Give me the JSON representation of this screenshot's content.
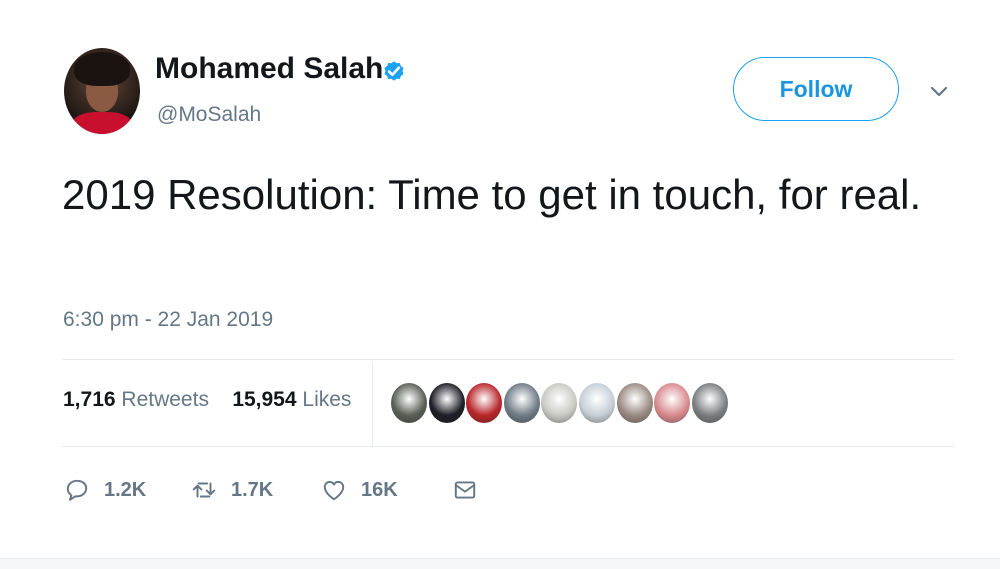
{
  "author": {
    "name": "Mohamed Salah",
    "handle": "@MoSalah",
    "verified": true
  },
  "follow_button": {
    "label": "Follow"
  },
  "tweet": {
    "text": "2019 Resolution: Time to get in touch, for real.",
    "timestamp": "6:30 pm - 22 Jan 2019"
  },
  "stats": {
    "retweets_count": "1,716",
    "retweets_label": "Retweets",
    "likes_count": "15,954",
    "likes_label": "Likes"
  },
  "likers": [
    {
      "name": "liker-1",
      "color": "#5a5e55"
    },
    {
      "name": "liker-2",
      "color": "#1e1e26"
    },
    {
      "name": "liker-3",
      "color": "#b8262a"
    },
    {
      "name": "liker-4",
      "color": "#6f7b86"
    },
    {
      "name": "liker-5",
      "color": "#c9c9c4"
    },
    {
      "name": "liker-6",
      "color": "#c6cfd6"
    },
    {
      "name": "liker-7",
      "color": "#9a8a82"
    },
    {
      "name": "liker-8",
      "color": "#d88a8e"
    },
    {
      "name": "liker-9",
      "color": "#7c7e80"
    }
  ],
  "actions": {
    "reply_count": "1.2K",
    "retweet_count": "1.7K",
    "like_count": "16K"
  },
  "icons": {
    "verified": "verified-badge-icon",
    "caret": "chevron-down-icon",
    "reply": "reply-icon",
    "retweet": "retweet-icon",
    "like": "heart-icon",
    "dm": "envelope-icon"
  },
  "colors": {
    "accent": "#1da1f2",
    "text": "#14171a",
    "muted": "#657786"
  }
}
